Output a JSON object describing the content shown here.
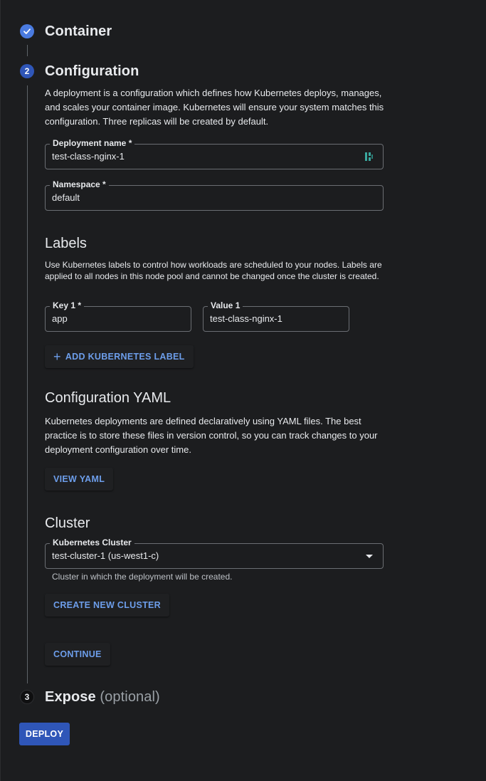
{
  "steps": [
    {
      "number": "",
      "title": "Container",
      "status": "done"
    },
    {
      "number": "2",
      "title": "Configuration",
      "status": "active"
    },
    {
      "number": "3",
      "title": "Expose",
      "optional_label": "(optional)",
      "status": "todo"
    }
  ],
  "configuration": {
    "description": "A deployment is a configuration which defines how Kubernetes deploys, manages, and scales your container image. Kubernetes will ensure your system matches this configuration. Three replicas will be created by default.",
    "deployment_name": {
      "label": "Deployment name *",
      "value": "test-class-nginx-1"
    },
    "namespace": {
      "label": "Namespace *",
      "value": "default"
    }
  },
  "labels": {
    "title": "Labels",
    "description": "Use Kubernetes labels to control how workloads are scheduled to your nodes. Labels are applied to all nodes in this node pool and cannot be changed once the cluster is created.",
    "key1": {
      "label": "Key 1 *",
      "value": "app"
    },
    "value1": {
      "label": "Value 1",
      "value": "test-class-nginx-1"
    },
    "add_button": "ADD KUBERNETES LABEL"
  },
  "yaml": {
    "title": "Configuration YAML",
    "description": "Kubernetes deployments are defined declaratively using YAML files. The best practice is to store these files in version control, so you can track changes to your deployment configuration over time.",
    "view_button": "VIEW YAML"
  },
  "cluster": {
    "title": "Cluster",
    "field": {
      "label": "Kubernetes Cluster",
      "value": "test-cluster-1 (us-west1-c)"
    },
    "helper": "Cluster in which the deployment will be created.",
    "create_button": "CREATE NEW CLUSTER"
  },
  "continue_button": "CONTINUE",
  "deploy_button": "DEPLOY",
  "colors": {
    "background": "#1c1d1f",
    "accent": "#6d9eeb",
    "primary_button": "#2f56b8",
    "step_done": "#4a7be0"
  },
  "icons": {
    "step_done": "check-icon",
    "deployment_field": "key-icon",
    "add": "plus-icon",
    "cluster_select": "dropdown-caret-icon"
  }
}
